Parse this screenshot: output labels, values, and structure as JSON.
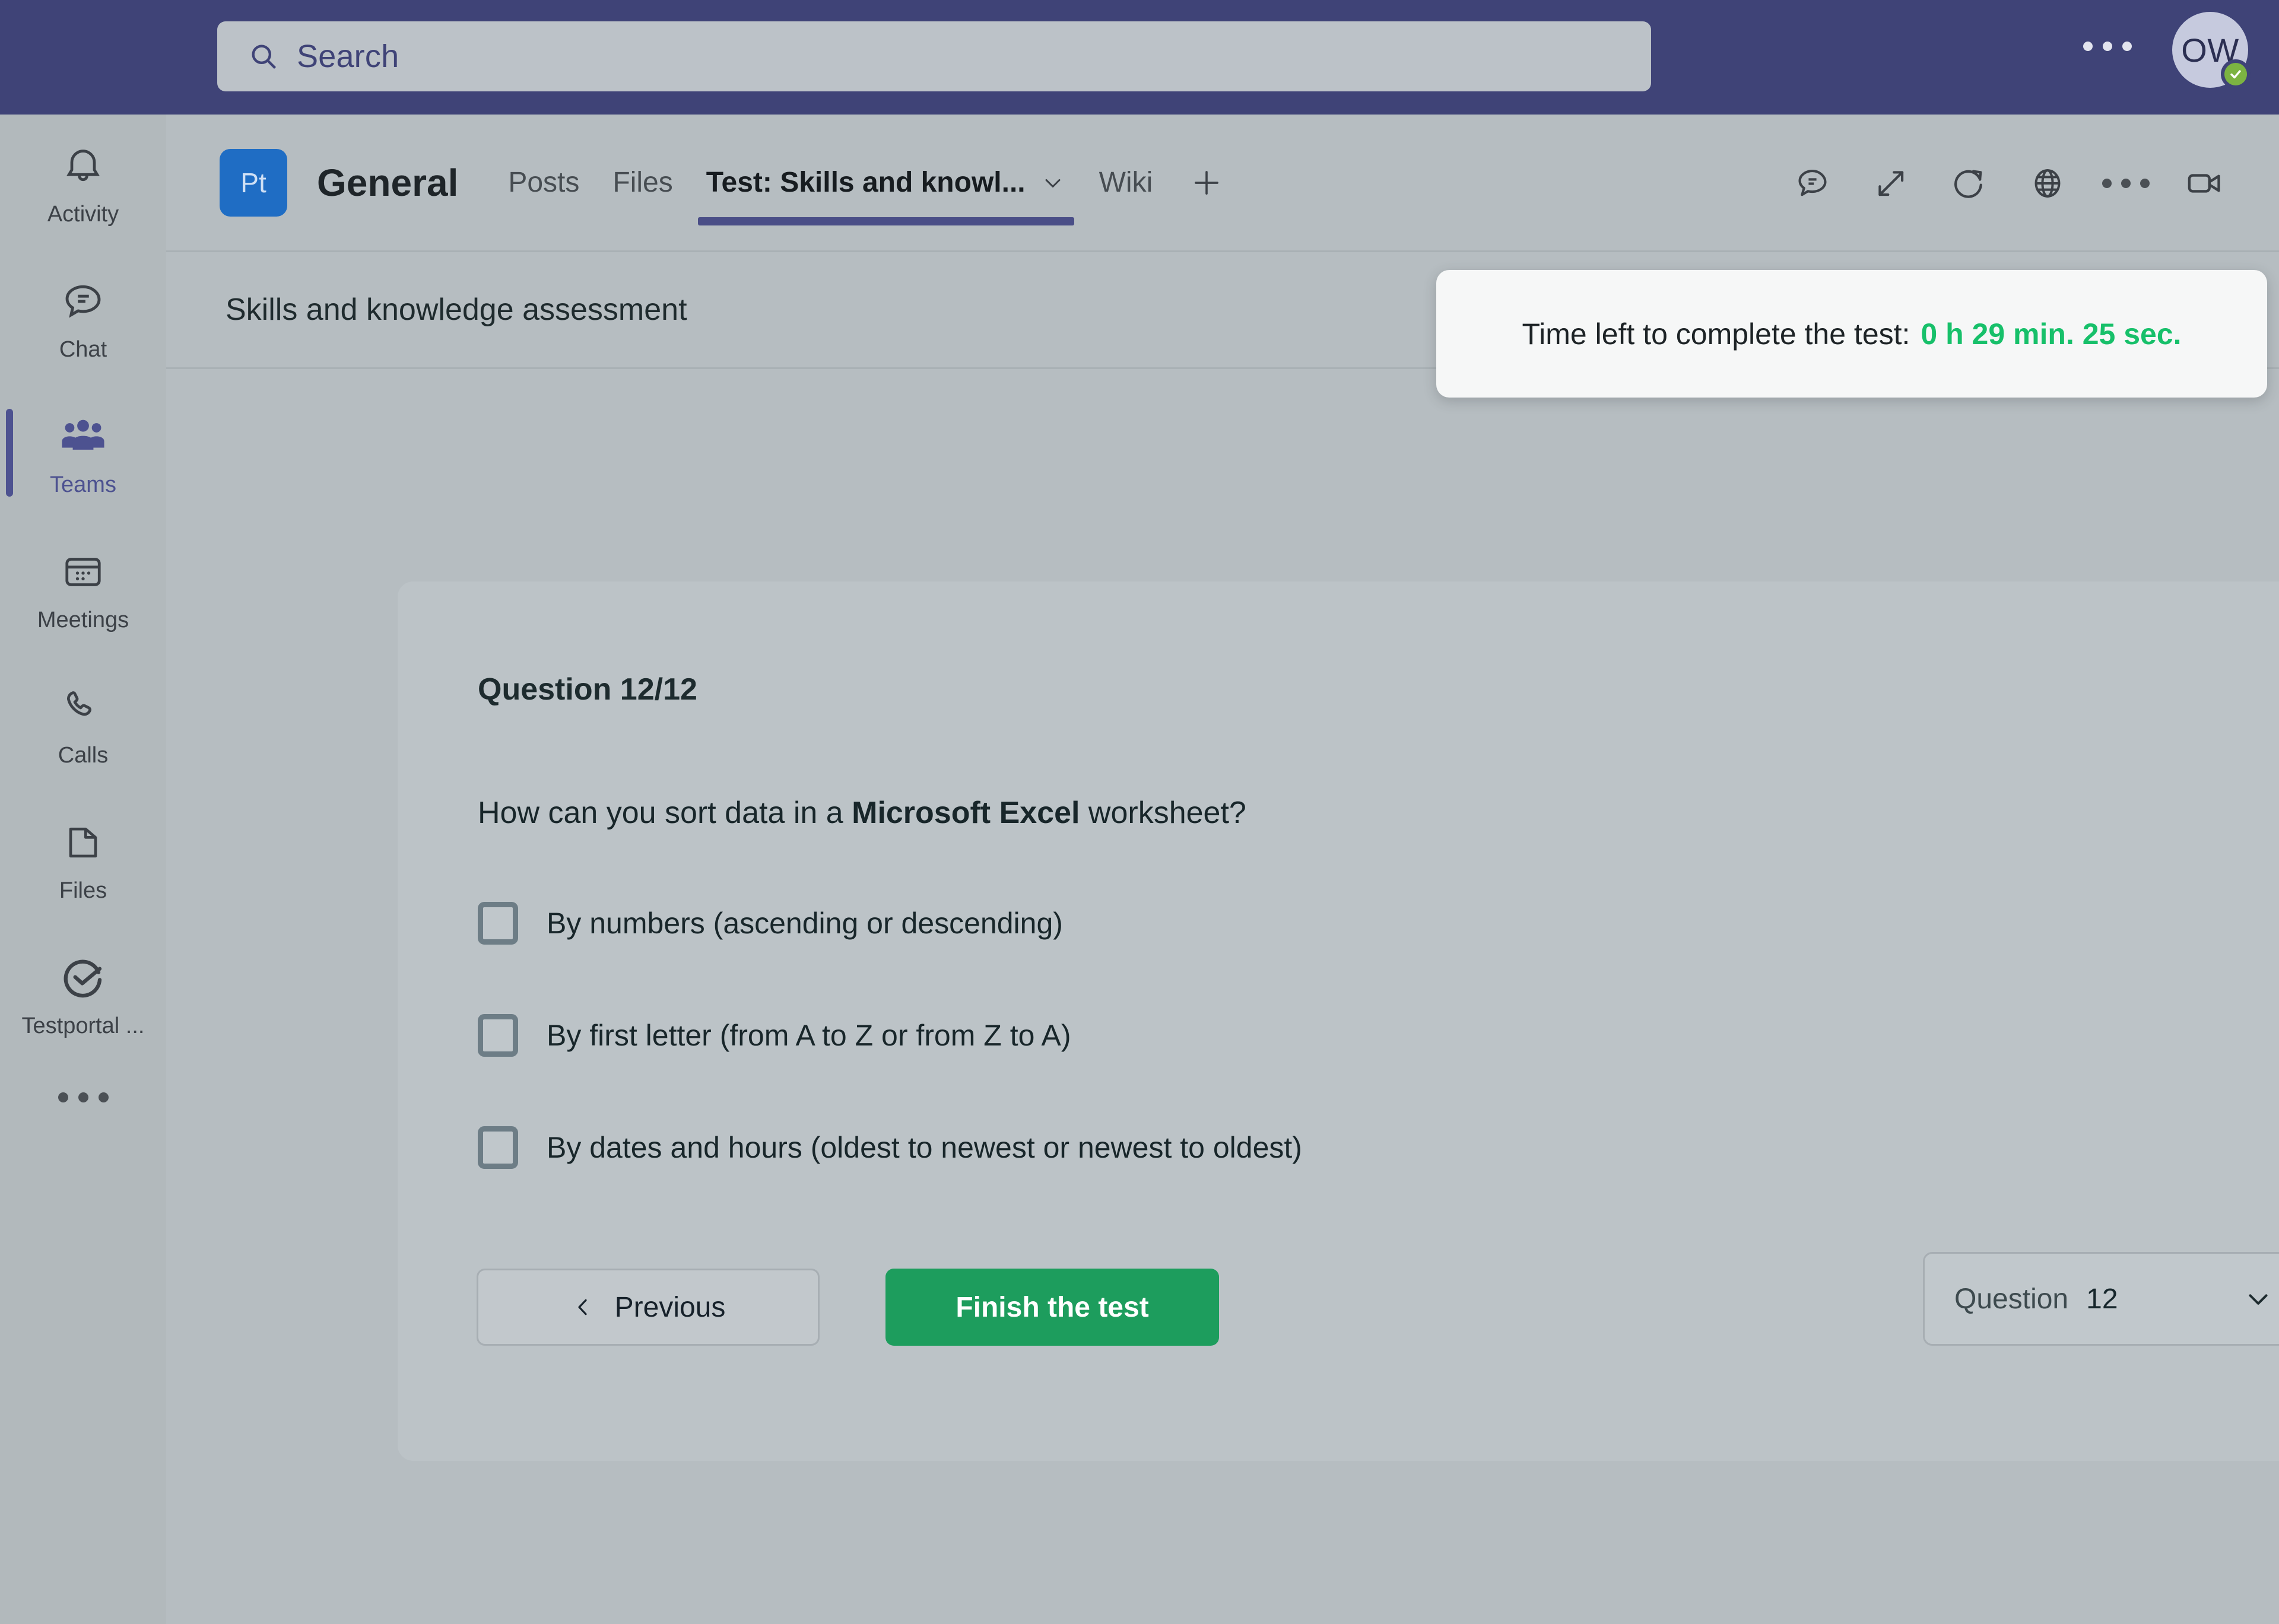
{
  "topbar": {
    "search": {
      "placeholder": "Search",
      "icon": "search-icon",
      "value": ""
    },
    "more_label": "more-options",
    "avatar": {
      "initials": "OW",
      "presence": "available"
    }
  },
  "sidebar": {
    "items": [
      {
        "label": "Activity",
        "icon": "bell-icon",
        "active": false
      },
      {
        "label": "Chat",
        "icon": "chat-bubble-icon",
        "active": false
      },
      {
        "label": "Teams",
        "icon": "people-icon",
        "active": true
      },
      {
        "label": "Meetings",
        "icon": "calendar-icon",
        "active": false
      },
      {
        "label": "Calls",
        "icon": "phone-icon",
        "active": false
      },
      {
        "label": "Files",
        "icon": "document-icon",
        "active": false
      },
      {
        "label": "Testportal ...",
        "icon": "check-circle-icon",
        "active": false
      }
    ],
    "more_label": "more-apps"
  },
  "channel": {
    "team_initials": "Pt",
    "title": "General",
    "tabs": [
      {
        "label": "Posts",
        "active": false
      },
      {
        "label": "Files",
        "active": false
      },
      {
        "label": "Test: Skills and knowl...",
        "active": true
      },
      {
        "label": "Wiki",
        "active": false
      }
    ],
    "add_tab_label": "+",
    "actions": [
      {
        "name": "conversation-icon"
      },
      {
        "name": "expand-icon"
      },
      {
        "name": "refresh-icon"
      },
      {
        "name": "globe-icon"
      },
      {
        "name": "more-icon"
      },
      {
        "name": "video-camera-icon"
      }
    ]
  },
  "app_header": {
    "title": "Skills and knowledge assessment"
  },
  "timer": {
    "label": "Time left to complete the test:",
    "value": "0 h 29 min. 25 sec.",
    "color": "#17c06a"
  },
  "question": {
    "counter": "Question 12/12",
    "text_before": "How can you sort data in a ",
    "text_bold": "Microsoft Excel",
    "text_after": " worksheet?",
    "options": [
      {
        "label": "By numbers (ascending or descending)",
        "checked": false
      },
      {
        "label": "By first letter  (from A to Z or from Z to A)",
        "checked": false
      },
      {
        "label": "By dates and hours (oldest to newest or newest to oldest)",
        "checked": false
      }
    ]
  },
  "footer": {
    "previous_label": "Previous",
    "finish_label": "Finish the test",
    "selector_label": "Question",
    "selector_value": "12"
  }
}
